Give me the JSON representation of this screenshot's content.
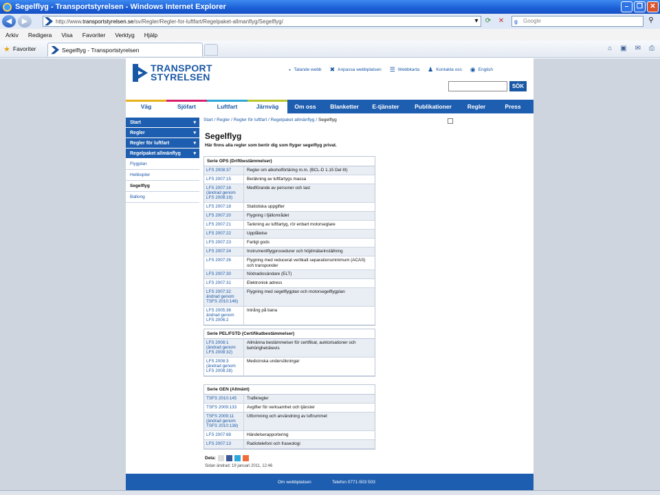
{
  "browser": {
    "title": "Segelflyg - Transportstyrelsen - Windows Internet Explorer",
    "url_prefix": "http://www.",
    "url_domain": "transportstyrelsen.se",
    "url_path": "/sv/Regler/Regler-for-luftfart/Regelpaket-allmanflyg/Segelflyg/",
    "search_placeholder": "Google",
    "menu": [
      "Arkiv",
      "Redigera",
      "Visa",
      "Favoriter",
      "Verktyg",
      "Hjälp"
    ],
    "favorites_label": "Favoriter",
    "tab_title": "Segelflyg - Transportstyrelsen"
  },
  "header": {
    "logo_line1": "TRANSPORT",
    "logo_line2": "STYRELSEN",
    "toplinks": [
      {
        "label": "Talande webb",
        "icon": "speaker-icon"
      },
      {
        "label": "Anpassa webbplatsen",
        "icon": "tools-icon"
      },
      {
        "label": "Webbkarta",
        "icon": "sitemap-icon"
      },
      {
        "label": "Kontakta oss",
        "icon": "people-icon"
      },
      {
        "label": "English",
        "icon": "globe-icon"
      }
    ],
    "search_button": "SÖK"
  },
  "nav": [
    "Väg",
    "Sjöfart",
    "Luftfart",
    "Järnväg",
    "Om oss",
    "Blanketter",
    "E-tjänster",
    "Publikationer",
    "Regler",
    "Press"
  ],
  "sidebar": {
    "dark": [
      "Start",
      "Regler",
      "Regler för luftfart",
      "Regelpaket allmänflyg"
    ],
    "light": [
      "Flygplan",
      "Helikopter",
      "Segelflyg",
      "Ballong"
    ]
  },
  "breadcrumb": {
    "items": [
      "Start",
      "Regler",
      "Regler för luftfart",
      "Regelpaket allmänflyg"
    ],
    "current": "Segelflyg",
    "separator": " / "
  },
  "page": {
    "title": "Segelflyg",
    "intro": "Här finns alla regler som berör dig som flyger segelflyg privat."
  },
  "groups": [
    {
      "heading": "Serie OPS (Driftbestämmelser)",
      "rows": [
        {
          "code": "LFS 2008:37",
          "text": "Regler om alkoholförtäring m.m. (BCL-D 1.15 Del III)"
        },
        {
          "code": "LFS 2007:15",
          "text": "Beräkning av luftfartygs massa"
        },
        {
          "code": "LFS 2007:16 (ändrad genom LFS 2008:19)",
          "text": "Medförande av personer och last"
        },
        {
          "code": "LFS 2007:18",
          "text": "Statistiska uppgifter"
        },
        {
          "code": "LFS 2007:20",
          "text": "Flygning i fjällområdet"
        },
        {
          "code": "LFS 2007:21",
          "text": "Tankning av luftfartyg, rör enbart motorseglare"
        },
        {
          "code": "LFS 2007:22",
          "text": "Upplåtelse"
        },
        {
          "code": "LFS 2007:23",
          "text": "Farligt gods"
        },
        {
          "code": "LFS 2007:24",
          "text": "Instrumentflygprocedurer och höjdmätarinställning"
        },
        {
          "code": "LFS 2007:26",
          "text": "Flygning med reducerat vertikalt separationsminimum (ACAS) och transponder"
        },
        {
          "code": "LFS 2007:30",
          "text": "Nödradiosändare (ELT)"
        },
        {
          "code": "LFS 2007:31",
          "text": "Elektronisk adress"
        },
        {
          "code": "LFS 2007:32 ändrad genom TSFS 2010:146)",
          "text": "Flygning med segelflygplan och motorsegelflygplan"
        },
        {
          "code": "LFS 2005:36 ändrad genom LFS 2006:2",
          "text": "Intrång på bana"
        }
      ]
    },
    {
      "heading": "Serie PEL/FSTD (Certifikatbestämmelser)",
      "rows": [
        {
          "code": "LFS 2008:1 (ändrad genom LFS 2008:32)",
          "text": "Allmänna bestämmelser för certifikat, auktorisationer och behörighetsbevis"
        },
        {
          "code": "LFS 2008:3 (ändrad genom LFS 2008:28)",
          "text": "Medicinska undersökningar"
        }
      ]
    },
    {
      "heading": "Serie GEN (Allmänt)",
      "rows": [
        {
          "code": "TSFS 2010:145",
          "text": "Trafikregler"
        },
        {
          "code": "TSFS 2009:133",
          "text": "Avgifter för verksamhet och tjänster"
        },
        {
          "code": "TSFS 2009:11 (ändrad genom TSFS 2010:138)",
          "text": "Utformning och användning av luftrummet"
        },
        {
          "code": "LFS 2007:68",
          "text": "Händelserapportering"
        },
        {
          "code": "LFS 2007:13",
          "text": "Radiotelefoni och fraseologi"
        }
      ]
    }
  ],
  "share_label": "Dela:",
  "updated": "Sidan ändrad: 19 januari 2011, 12:46",
  "footer": {
    "about": "Om webbplatsen",
    "phone": "Telefon 0771-503 503"
  },
  "colors": {
    "brand_blue": "#1e5eb0",
    "ie_blue": "#1b5fd6"
  }
}
